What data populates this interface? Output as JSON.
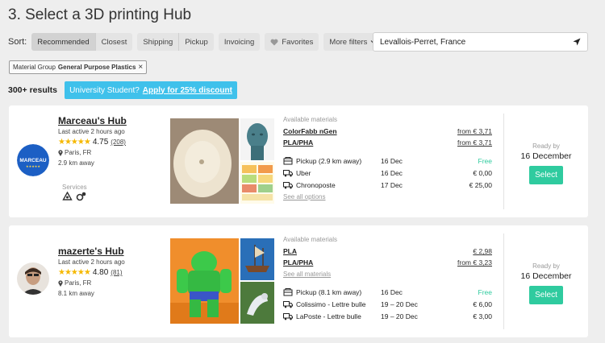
{
  "page": {
    "title": "3. Select a 3D printing Hub"
  },
  "sort": {
    "label": "Sort:",
    "buttons": [
      "Recommended",
      "Closest",
      "Shipping",
      "Pickup",
      "Invoicing",
      "Favorites",
      "More filters"
    ]
  },
  "location": {
    "value": "Levallois-Perret, France"
  },
  "filter_chip": {
    "prefix": "Material Group",
    "value": "General Purpose Plastics"
  },
  "results": {
    "count": "300+ results"
  },
  "promo": {
    "text": "University Student?",
    "link": "Apply for 25% discount"
  },
  "hubs": [
    {
      "logo_text": "MARCEAU",
      "name": "Marceau's Hub",
      "last_active": "Last active 2 hours ago",
      "rating": "4.75",
      "stars": "★★★★★",
      "reviews": "(208)",
      "location": "Paris, FR",
      "distance": "2.9 km away",
      "services_label": "Services",
      "available_label": "Available materials",
      "materials": [
        {
          "name": "ColorFabb nGen",
          "price": "from € 3,71"
        },
        {
          "name": "PLA/PHA",
          "price": "from € 3,71"
        }
      ],
      "see_all": "See all options",
      "shipping": [
        {
          "name": "Pickup (2.9 km away)",
          "date": "16 Dec",
          "price": "Free",
          "icon": "pickup-icon"
        },
        {
          "name": "Uber",
          "date": "16 Dec",
          "price": "€ 0,00",
          "icon": "truck-icon"
        },
        {
          "name": "Chronoposte",
          "date": "17 Dec",
          "price": "€ 25,00",
          "icon": "truck-icon"
        }
      ],
      "ready_label": "Ready by",
      "ready_date": "16 December",
      "select": "Select"
    },
    {
      "name": "mazerte's Hub",
      "last_active": "Last active 2 hours ago",
      "rating": "4.80",
      "stars": "★★★★★",
      "reviews": "(81)",
      "location": "Paris, FR",
      "distance": "8.1 km away",
      "available_label": "Available materials",
      "materials": [
        {
          "name": "PLA",
          "price": "€ 2,98"
        },
        {
          "name": "PLA/PHA",
          "price": "from € 3,23"
        }
      ],
      "see_all": "See all materials",
      "shipping": [
        {
          "name": "Pickup (8.1 km away)",
          "date": "16 Dec",
          "price": "Free",
          "icon": "pickup-icon"
        },
        {
          "name": "Colissimo - Lettre bulle",
          "date": "19 – 20 Dec",
          "price": "€ 6,00",
          "icon": "truck-icon"
        },
        {
          "name": "LaPoste - Lettre bulle",
          "date": "19 – 20 Dec",
          "price": "€ 3,00",
          "icon": "truck-icon"
        }
      ],
      "ready_label": "Ready by",
      "ready_date": "16 December",
      "select": "Select"
    }
  ],
  "colors": {
    "accent": "#2fcb9f",
    "promo": "#3fc1eb",
    "stars": "#f5b800"
  }
}
